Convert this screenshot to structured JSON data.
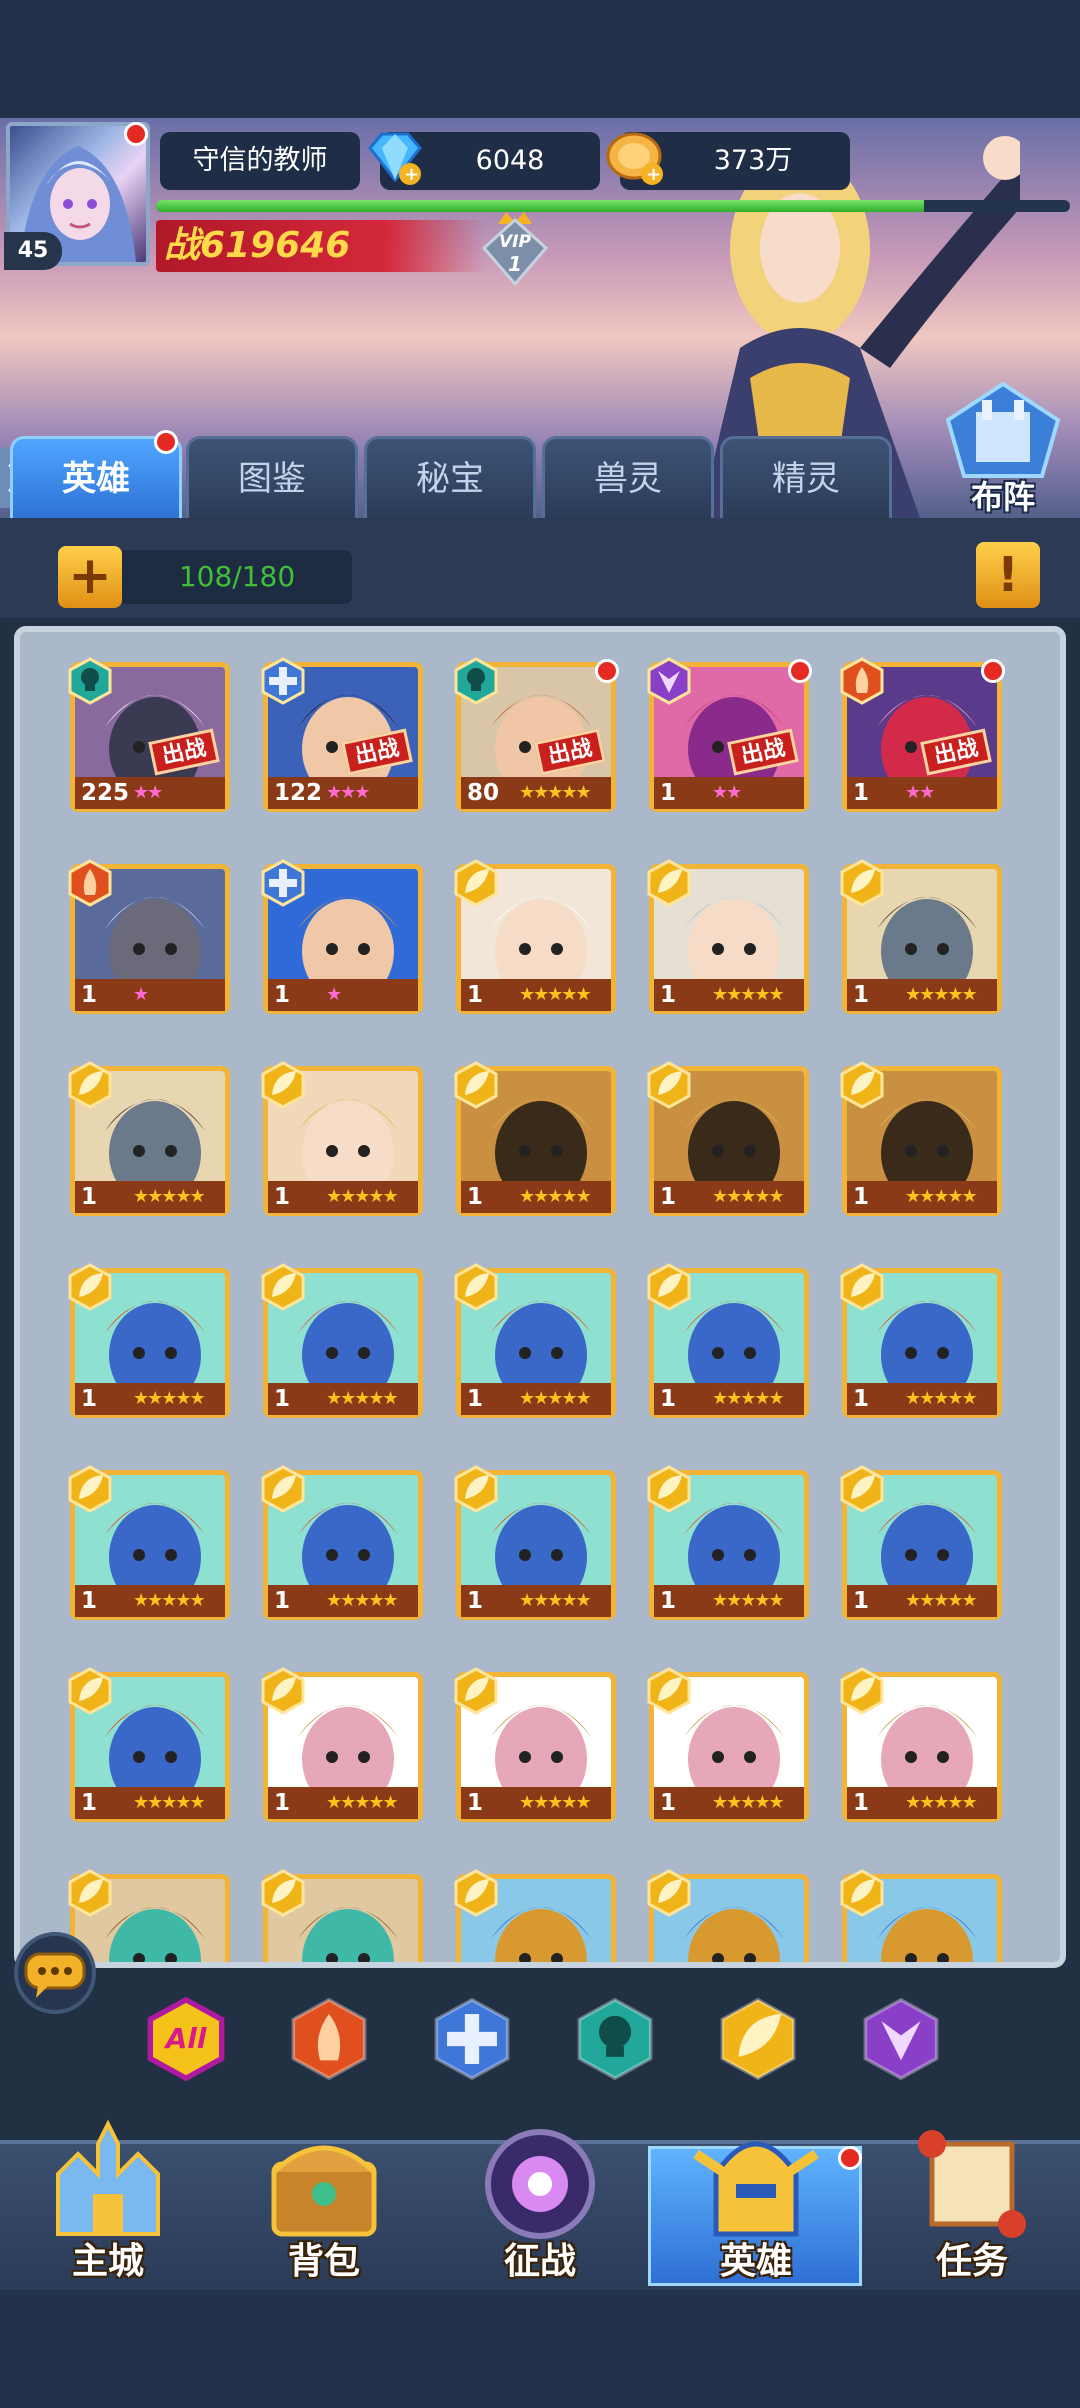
{
  "player": {
    "name": "守信的教师",
    "level": "45",
    "gems": "6048",
    "gold": "373万",
    "power_prefix": "战",
    "power": "619646",
    "vip": "VIP",
    "vip_level": "1",
    "exp_fraction": 0.84
  },
  "tabs": [
    {
      "label": "英雄",
      "active": true,
      "badge": true
    },
    {
      "label": "图鉴",
      "active": false
    },
    {
      "label": "秘宝",
      "active": false
    },
    {
      "label": "兽灵",
      "active": false
    },
    {
      "label": "精灵",
      "active": false
    }
  ],
  "formation_label": "布阵",
  "hero_count": "108/180",
  "deploy_label": "出战",
  "heroes": [
    {
      "level": "225",
      "stars": "★★",
      "star_color": "red",
      "faction": "skull",
      "deployed": true,
      "badge": false,
      "portrait": "dark-beast"
    },
    {
      "level": "122",
      "stars": "★★★",
      "star_color": "pink",
      "faction": "cross",
      "deployed": true,
      "badge": false,
      "portrait": "dark-hair-man"
    },
    {
      "level": "80",
      "stars": "★★★★★",
      "star_color": "gold",
      "faction": "skull",
      "deployed": true,
      "badge": true,
      "portrait": "elf-red-hair"
    },
    {
      "level": "1",
      "stars": "★★",
      "star_color": "pink",
      "faction": "purple",
      "deployed": true,
      "badge": true,
      "portrait": "purple-beast"
    },
    {
      "level": "1",
      "stars": "★★",
      "star_color": "pink",
      "faction": "fire",
      "deployed": true,
      "badge": true,
      "portrait": "red-dragon"
    },
    {
      "level": "1",
      "stars": "★",
      "star_color": "pink",
      "faction": "fire",
      "deployed": false,
      "badge": false,
      "portrait": "gray-undead"
    },
    {
      "level": "1",
      "stars": "★",
      "star_color": "pink",
      "faction": "cross",
      "deployed": false,
      "badge": false,
      "portrait": "golden-knight"
    },
    {
      "level": "1",
      "stars": "★★★★★",
      "star_color": "gold",
      "faction": "leaf",
      "deployed": false,
      "badge": false,
      "portrait": "white-hair"
    },
    {
      "level": "1",
      "stars": "★★★★★",
      "star_color": "gold",
      "faction": "leaf",
      "deployed": false,
      "badge": false,
      "portrait": "silver-knight"
    },
    {
      "level": "1",
      "stars": "★★★★★",
      "star_color": "gold",
      "faction": "leaf",
      "deployed": false,
      "badge": false,
      "portrait": "hooded-elephant"
    },
    {
      "level": "1",
      "stars": "★★★★★",
      "star_color": "gold",
      "faction": "leaf",
      "deployed": false,
      "badge": false,
      "portrait": "hooded-elephant"
    },
    {
      "level": "1",
      "stars": "★★★★★",
      "star_color": "gold",
      "faction": "leaf",
      "deployed": false,
      "badge": false,
      "portrait": "blonde-girl"
    },
    {
      "level": "1",
      "stars": "★★★★★",
      "star_color": "gold",
      "faction": "leaf",
      "deployed": false,
      "badge": false,
      "portrait": "anubis"
    },
    {
      "level": "1",
      "stars": "★★★★★",
      "star_color": "gold",
      "faction": "leaf",
      "deployed": false,
      "badge": false,
      "portrait": "anubis"
    },
    {
      "level": "1",
      "stars": "★★★★★",
      "star_color": "gold",
      "faction": "leaf",
      "deployed": false,
      "badge": false,
      "portrait": "anubis"
    },
    {
      "level": "1",
      "stars": "★★★★★",
      "star_color": "gold",
      "faction": "leaf",
      "deployed": false,
      "badge": false,
      "portrait": "blue-troll"
    },
    {
      "level": "1",
      "stars": "★★★★★",
      "star_color": "gold",
      "faction": "leaf",
      "deployed": false,
      "badge": false,
      "portrait": "blue-troll"
    },
    {
      "level": "1",
      "stars": "★★★★★",
      "star_color": "gold",
      "faction": "leaf",
      "deployed": false,
      "badge": false,
      "portrait": "blue-troll"
    },
    {
      "level": "1",
      "stars": "★★★★★",
      "star_color": "gold",
      "faction": "leaf",
      "deployed": false,
      "badge": false,
      "portrait": "blue-troll"
    },
    {
      "level": "1",
      "stars": "★★★★★",
      "star_color": "gold",
      "faction": "leaf",
      "deployed": false,
      "badge": false,
      "portrait": "blue-troll"
    },
    {
      "level": "1",
      "stars": "★★★★★",
      "star_color": "gold",
      "faction": "leaf",
      "deployed": false,
      "badge": false,
      "portrait": "blue-troll"
    },
    {
      "level": "1",
      "stars": "★★★★★",
      "star_color": "gold",
      "faction": "leaf",
      "deployed": false,
      "badge": false,
      "portrait": "blue-troll"
    },
    {
      "level": "1",
      "stars": "★★★★★",
      "star_color": "gold",
      "faction": "leaf",
      "deployed": false,
      "badge": false,
      "portrait": "blue-troll"
    },
    {
      "level": "1",
      "stars": "★★★★★",
      "star_color": "gold",
      "faction": "leaf",
      "deployed": false,
      "badge": false,
      "portrait": "blue-troll"
    },
    {
      "level": "1",
      "stars": "★★★★★",
      "star_color": "gold",
      "faction": "leaf",
      "deployed": false,
      "badge": false,
      "portrait": "blue-troll"
    },
    {
      "level": "1",
      "stars": "★★★★★",
      "star_color": "gold",
      "faction": "leaf",
      "deployed": false,
      "badge": false,
      "portrait": "blue-troll"
    },
    {
      "level": "1",
      "stars": "★★★★★",
      "star_color": "gold",
      "faction": "leaf",
      "deployed": false,
      "badge": false,
      "portrait": "hooded-pink"
    },
    {
      "level": "1",
      "stars": "★★★★★",
      "star_color": "gold",
      "faction": "leaf",
      "deployed": false,
      "badge": false,
      "portrait": "hooded-pink"
    },
    {
      "level": "1",
      "stars": "★★★★★",
      "star_color": "gold",
      "faction": "leaf",
      "deployed": false,
      "badge": false,
      "portrait": "hooded-pink"
    },
    {
      "level": "1",
      "stars": "★★★★★",
      "star_color": "gold",
      "faction": "leaf",
      "deployed": false,
      "badge": false,
      "portrait": "hooded-pink"
    },
    {
      "level": "",
      "stars": "",
      "star_color": "gold",
      "faction": "leaf",
      "deployed": false,
      "badge": false,
      "portrait": "teal-elf",
      "partial": true
    },
    {
      "level": "",
      "stars": "",
      "star_color": "gold",
      "faction": "leaf",
      "deployed": false,
      "badge": false,
      "portrait": "teal-elf",
      "partial": true
    },
    {
      "level": "",
      "stars": "",
      "star_color": "gold",
      "faction": "leaf",
      "deployed": false,
      "badge": false,
      "portrait": "gold-visor",
      "partial": true
    },
    {
      "level": "",
      "stars": "",
      "star_color": "gold",
      "faction": "leaf",
      "deployed": false,
      "badge": false,
      "portrait": "gold-visor",
      "partial": true
    },
    {
      "level": "",
      "stars": "",
      "star_color": "gold",
      "faction": "leaf",
      "deployed": false,
      "badge": false,
      "portrait": "gold-visor",
      "partial": true
    }
  ],
  "filters": [
    {
      "name": "all",
      "label": "All",
      "color": "#f5c21a"
    },
    {
      "name": "fire",
      "label": "",
      "color": "#e0501e"
    },
    {
      "name": "cross",
      "label": "",
      "color": "#3f77d8"
    },
    {
      "name": "skull",
      "label": "",
      "color": "#22a79b"
    },
    {
      "name": "leaf",
      "label": "",
      "color": "#f0b418"
    },
    {
      "name": "purple",
      "label": "",
      "color": "#8a3fc8"
    }
  ],
  "nav": [
    {
      "label": "主城",
      "active": false,
      "icon": "castle-icon"
    },
    {
      "label": "背包",
      "active": false,
      "icon": "chest-icon"
    },
    {
      "label": "征战",
      "active": false,
      "icon": "dragon-portal-icon"
    },
    {
      "label": "英雄",
      "active": true,
      "icon": "helmet-icon",
      "badge": true
    },
    {
      "label": "任务",
      "active": false,
      "icon": "scroll-icon"
    }
  ],
  "colors": {
    "accent": "#2e72d6",
    "gold": "#f1b437",
    "power_red": "#d4283a",
    "exp_green": "#3fbf3a"
  }
}
